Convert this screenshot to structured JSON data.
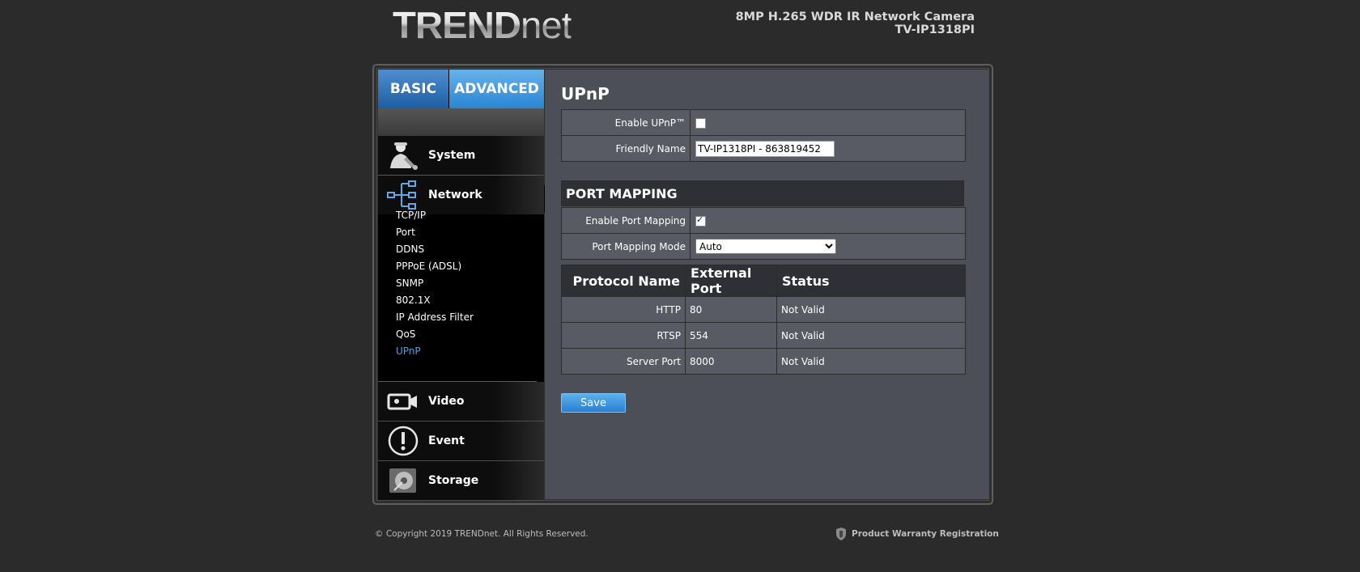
{
  "header": {
    "logo_main": "TREND",
    "logo_sub": "net",
    "product_line1": "8MP H.265 WDR IR Network Camera",
    "product_line2": "TV-IP1318PI"
  },
  "tabs": {
    "basic": "BASIC",
    "advanced": "ADVANCED"
  },
  "sidebar": {
    "sections": {
      "system": "System",
      "network": "Network",
      "video": "Video",
      "event": "Event",
      "storage": "Storage"
    },
    "network_items": [
      "TCP/IP",
      "Port",
      "DDNS",
      "PPPoE (ADSL)",
      "SNMP",
      "802.1X",
      "IP Address Filter",
      "QoS",
      "UPnP"
    ],
    "active_item": "UPnP"
  },
  "content": {
    "title": "UPnP",
    "enable_upnp_label": "Enable UPnP™",
    "enable_upnp_checked": false,
    "friendly_name_label": "Friendly Name",
    "friendly_name_value": "TV-IP1318PI - 863819452",
    "port_mapping_header": "PORT MAPPING",
    "enable_port_mapping_label": "Enable Port Mapping",
    "enable_port_mapping_checked": true,
    "port_mapping_mode_label": "Port Mapping Mode",
    "port_mapping_mode_value": "Auto",
    "ports_table": {
      "headers": [
        "Protocol Name",
        "External Port",
        "Status"
      ],
      "rows": [
        [
          "HTTP",
          "80",
          "Not Valid"
        ],
        [
          "RTSP",
          "554",
          "Not Valid"
        ],
        [
          "Server Port",
          "8000",
          "Not Valid"
        ]
      ]
    },
    "save_label": "Save"
  },
  "footer": {
    "copyright": "© Copyright 2019 TRENDnet. All Rights Reserved.",
    "warranty": "Product Warranty Registration"
  },
  "colors": {
    "accent": "#2a86d3",
    "active_link": "#4da2e6",
    "content_bg": "#4c4f57"
  }
}
